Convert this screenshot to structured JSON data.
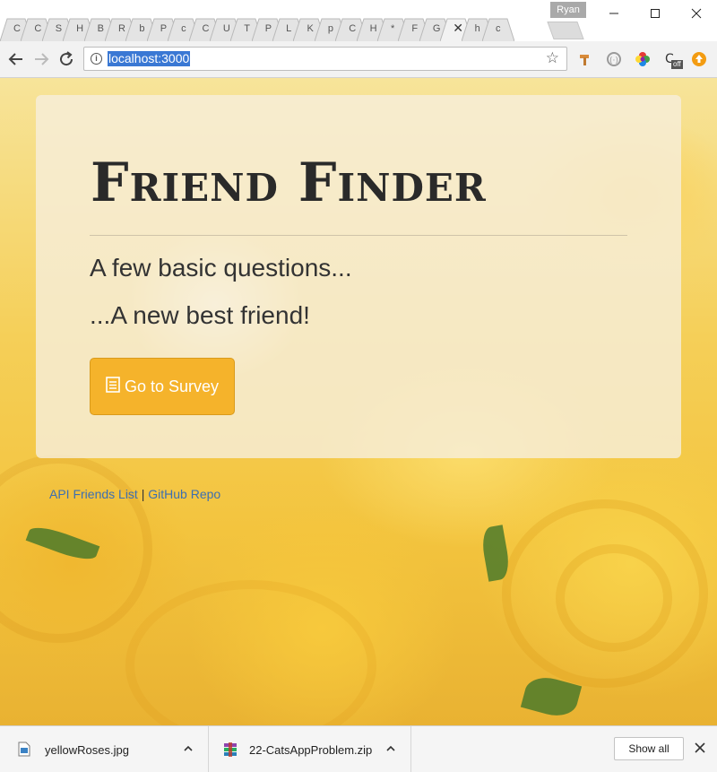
{
  "window": {
    "user_name": "Ryan",
    "tabs": [
      "C",
      "C",
      "S",
      "H",
      "B",
      "R",
      "b",
      "P",
      "c",
      "C",
      "U",
      "T",
      "P",
      "L",
      "K",
      "p",
      "C",
      "H",
      "*",
      "F",
      "G",
      "✕",
      "h",
      "c"
    ]
  },
  "toolbar": {
    "url": "localhost:3000"
  },
  "page": {
    "title": "Friend Finder",
    "lead_1": "A few basic questions...",
    "lead_2": "...A new best friend!",
    "survey_button": "Go to Survey",
    "link_api": "API Friends List",
    "link_separator": "|",
    "link_github": "GitHub Repo",
    "colors": {
      "button": "#f5b32b",
      "link": "#3d6fb0"
    }
  },
  "downloads": {
    "items": [
      {
        "name": "yellowRoses.jpg",
        "icon": "image-file-icon"
      },
      {
        "name": "22-CatsAppProblem.zip",
        "icon": "archive-file-icon"
      }
    ],
    "show_all": "Show all"
  }
}
